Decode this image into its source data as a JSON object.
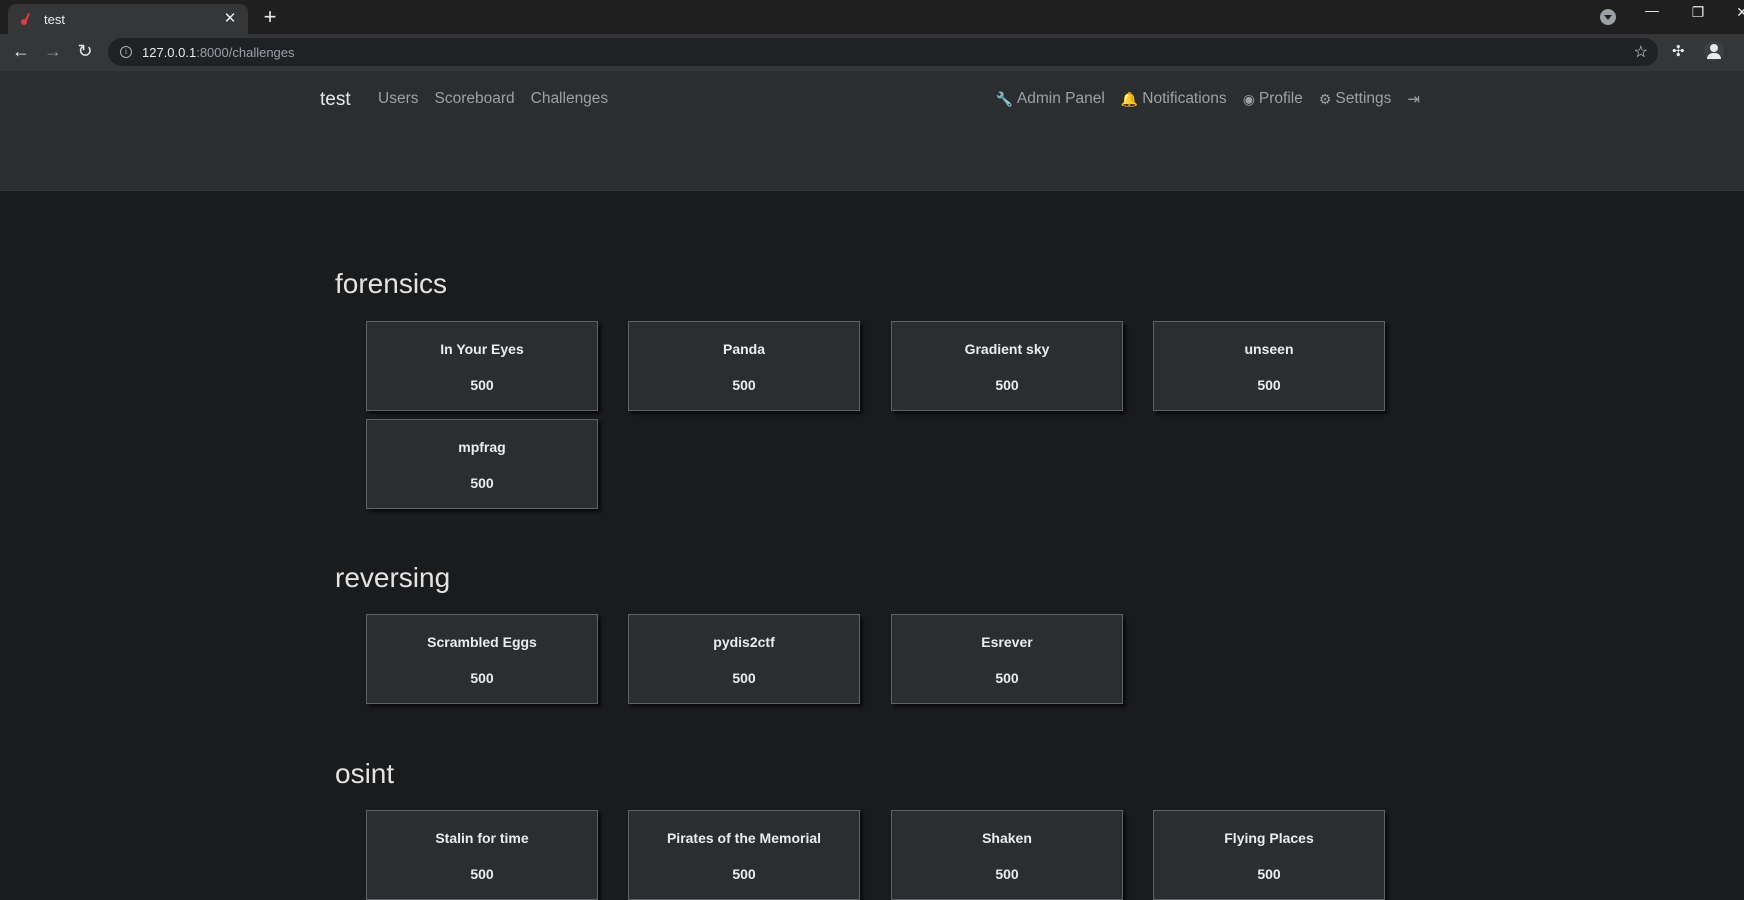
{
  "browser": {
    "tab_title": "test",
    "tab_close": "✕",
    "new_tab": "+",
    "url_host": "127.0.0.1",
    "url_path": ":8000/challenges",
    "window_min": "—",
    "window_restore": "❐",
    "window_close": "✕"
  },
  "site": {
    "brand": "test",
    "nav_left": [
      "Users",
      "Scoreboard",
      "Challenges"
    ],
    "nav_right": [
      {
        "icon": "wrench-icon",
        "glyph": "🔧",
        "label": "Admin Panel"
      },
      {
        "icon": "bell-icon",
        "glyph": "🔔",
        "label": "Notifications"
      },
      {
        "icon": "user-circle-icon",
        "glyph": "◉",
        "label": "Profile"
      },
      {
        "icon": "gears-icon",
        "glyph": "⚙",
        "label": "Settings"
      }
    ],
    "logout_glyph": "⇥"
  },
  "categories": [
    {
      "name": "forensics",
      "challenges": [
        {
          "name": "In Your Eyes",
          "value": "500"
        },
        {
          "name": "Panda",
          "value": "500"
        },
        {
          "name": "Gradient sky",
          "value": "500"
        },
        {
          "name": "unseen",
          "value": "500"
        },
        {
          "name": "mpfrag",
          "value": "500"
        }
      ]
    },
    {
      "name": "reversing",
      "challenges": [
        {
          "name": "Scrambled Eggs",
          "value": "500"
        },
        {
          "name": "pydis2ctf",
          "value": "500"
        },
        {
          "name": "Esrever",
          "value": "500"
        }
      ]
    },
    {
      "name": "osint",
      "challenges": [
        {
          "name": "Stalin for time",
          "value": "500"
        },
        {
          "name": "Pirates of the Memorial",
          "value": "500"
        },
        {
          "name": "Shaken",
          "value": "500"
        },
        {
          "name": "Flying Places",
          "value": "500"
        }
      ]
    }
  ],
  "colors": {
    "page_bg": "#1a1b1d",
    "header_bg": "#2b2e31",
    "card_bg": "#2b2e31",
    "card_border": "#5e6166"
  }
}
